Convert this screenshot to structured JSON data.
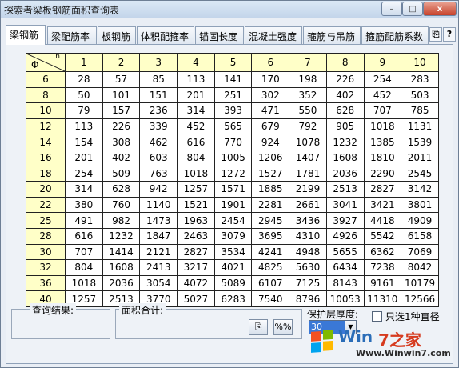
{
  "window": {
    "title": "探索者梁板钢筋面积查询表",
    "minimize_glyph": "–",
    "maximize_glyph": "□",
    "close_glyph": "x"
  },
  "tabs": [
    {
      "label": "梁钢筋",
      "active": true
    },
    {
      "label": "梁配筋率",
      "active": false
    },
    {
      "label": "板钢筋",
      "active": false
    },
    {
      "label": "体积配箍率",
      "active": false
    },
    {
      "label": "锚固长度",
      "active": false
    },
    {
      "label": "混凝土强度",
      "active": false
    },
    {
      "label": "箍筋与吊筋",
      "active": false
    },
    {
      "label": "箍筋配筋系数",
      "active": false
    }
  ],
  "table": {
    "corner_row_label": "Φ",
    "corner_col_label": "n",
    "columns": [
      "1",
      "2",
      "3",
      "4",
      "5",
      "6",
      "7",
      "8",
      "9",
      "10"
    ],
    "rows": [
      {
        "d": "6",
        "values": [
          "28",
          "57",
          "85",
          "113",
          "141",
          "170",
          "198",
          "226",
          "254",
          "283"
        ]
      },
      {
        "d": "8",
        "values": [
          "50",
          "101",
          "151",
          "201",
          "251",
          "302",
          "352",
          "402",
          "452",
          "503"
        ]
      },
      {
        "d": "10",
        "values": [
          "79",
          "157",
          "236",
          "314",
          "393",
          "471",
          "550",
          "628",
          "707",
          "785"
        ]
      },
      {
        "d": "12",
        "values": [
          "113",
          "226",
          "339",
          "452",
          "565",
          "679",
          "792",
          "905",
          "1018",
          "1131"
        ]
      },
      {
        "d": "14",
        "values": [
          "154",
          "308",
          "462",
          "616",
          "770",
          "924",
          "1078",
          "1232",
          "1385",
          "1539"
        ]
      },
      {
        "d": "16",
        "values": [
          "201",
          "402",
          "603",
          "804",
          "1005",
          "1206",
          "1407",
          "1608",
          "1810",
          "2011"
        ]
      },
      {
        "d": "18",
        "values": [
          "254",
          "509",
          "763",
          "1018",
          "1272",
          "1527",
          "1781",
          "2036",
          "2290",
          "2545"
        ]
      },
      {
        "d": "20",
        "values": [
          "314",
          "628",
          "942",
          "1257",
          "1571",
          "1885",
          "2199",
          "2513",
          "2827",
          "3142"
        ]
      },
      {
        "d": "22",
        "values": [
          "380",
          "760",
          "1140",
          "1521",
          "1901",
          "2281",
          "2661",
          "3041",
          "3421",
          "3801"
        ]
      },
      {
        "d": "25",
        "values": [
          "491",
          "982",
          "1473",
          "1963",
          "2454",
          "2945",
          "3436",
          "3927",
          "4418",
          "4909"
        ]
      },
      {
        "d": "28",
        "values": [
          "616",
          "1232",
          "1847",
          "2463",
          "3079",
          "3695",
          "4310",
          "4926",
          "5542",
          "6158"
        ]
      },
      {
        "d": "30",
        "values": [
          "707",
          "1414",
          "2121",
          "2827",
          "3534",
          "4241",
          "4948",
          "5655",
          "6362",
          "7069"
        ]
      },
      {
        "d": "32",
        "values": [
          "804",
          "1608",
          "2413",
          "3217",
          "4021",
          "4825",
          "5630",
          "6434",
          "7238",
          "8042"
        ]
      },
      {
        "d": "36",
        "values": [
          "1018",
          "2036",
          "3054",
          "4072",
          "5089",
          "6107",
          "7125",
          "8143",
          "9161",
          "10179"
        ]
      },
      {
        "d": "40",
        "values": [
          "1257",
          "2513",
          "3770",
          "5027",
          "6283",
          "7540",
          "8796",
          "10053",
          "11310",
          "12566"
        ]
      }
    ]
  },
  "bottom": {
    "query_result_label": "查询结果:",
    "area_total_label": "面积合计:",
    "percent_button": "%%",
    "cover_label": "保护层厚度:",
    "cover_value": "30",
    "single_diameter_label": "只选1种直径"
  },
  "watermark": {
    "brand_prefix": "Win",
    "brand_suffix": "7之家",
    "url": "Www.Winwin7.com"
  },
  "colors": {
    "header_fill": "#ffffc8",
    "panel_bg": "#eef2f7",
    "select_highlight": "#3a78d6"
  }
}
